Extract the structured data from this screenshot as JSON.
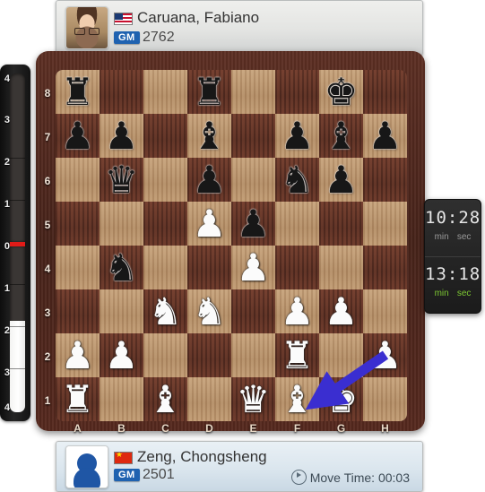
{
  "top_player": {
    "name": "Caruana, Fabiano",
    "title": "GM",
    "rating": "2762",
    "flag": "us-flag-icon",
    "avatar": "player-photo-avatar"
  },
  "bottom_player": {
    "name": "Zeng, Chongsheng",
    "title": "GM",
    "rating": "2501",
    "flag": "cn-flag-icon",
    "avatar": "silhouette-avatar",
    "move_time_label": "Move Time: 00:03"
  },
  "clocks": {
    "top": {
      "time": "10:28",
      "min_label": "min",
      "sec_label": "sec",
      "active": false
    },
    "bottom": {
      "time": "13:18",
      "min_label": "min",
      "sec_label": "sec",
      "active": true
    }
  },
  "evaluation_bar": {
    "labels_top_to_bottom": [
      "4",
      "3",
      "2",
      "1",
      "0",
      "1",
      "2",
      "3",
      "4"
    ],
    "zero_marker_color": "#e01b18",
    "white_fill_from": "-2.0",
    "white_advantage": true
  },
  "board": {
    "files": [
      "A",
      "B",
      "C",
      "D",
      "E",
      "F",
      "G",
      "H"
    ],
    "ranks": [
      "8",
      "7",
      "6",
      "5",
      "4",
      "3",
      "2",
      "1"
    ],
    "light_square_color": "#b08a63",
    "dark_square_color": "#5b2f23",
    "pieces": [
      {
        "sq": "a8",
        "glyph": "♜",
        "side": "b",
        "name": "black-rook"
      },
      {
        "sq": "d8",
        "glyph": "♜",
        "side": "b",
        "name": "black-rook"
      },
      {
        "sq": "g8",
        "glyph": "♚",
        "side": "b",
        "name": "black-king"
      },
      {
        "sq": "a7",
        "glyph": "♟",
        "side": "b",
        "name": "black-pawn"
      },
      {
        "sq": "b7",
        "glyph": "♟",
        "side": "b",
        "name": "black-pawn"
      },
      {
        "sq": "d7",
        "glyph": "♝",
        "side": "b",
        "name": "black-bishop"
      },
      {
        "sq": "f7",
        "glyph": "♟",
        "side": "b",
        "name": "black-pawn"
      },
      {
        "sq": "g7",
        "glyph": "♝",
        "side": "b",
        "name": "black-bishop"
      },
      {
        "sq": "h7",
        "glyph": "♟",
        "side": "b",
        "name": "black-pawn"
      },
      {
        "sq": "b6",
        "glyph": "♛",
        "side": "b",
        "name": "black-queen"
      },
      {
        "sq": "d6",
        "glyph": "♟",
        "side": "b",
        "name": "black-pawn"
      },
      {
        "sq": "f6",
        "glyph": "♞",
        "side": "b",
        "name": "black-knight"
      },
      {
        "sq": "g6",
        "glyph": "♟",
        "side": "b",
        "name": "black-pawn"
      },
      {
        "sq": "d5",
        "glyph": "♟",
        "side": "w",
        "name": "white-pawn"
      },
      {
        "sq": "e5",
        "glyph": "♟",
        "side": "b",
        "name": "black-pawn"
      },
      {
        "sq": "b4",
        "glyph": "♞",
        "side": "b",
        "name": "black-knight"
      },
      {
        "sq": "e4",
        "glyph": "♟",
        "side": "w",
        "name": "white-pawn"
      },
      {
        "sq": "c3",
        "glyph": "♞",
        "side": "w",
        "name": "white-knight"
      },
      {
        "sq": "d3",
        "glyph": "♞",
        "side": "w",
        "name": "white-knight"
      },
      {
        "sq": "f3",
        "glyph": "♟",
        "side": "w",
        "name": "white-pawn"
      },
      {
        "sq": "g3",
        "glyph": "♟",
        "side": "w",
        "name": "white-pawn"
      },
      {
        "sq": "a2",
        "glyph": "♟",
        "side": "w",
        "name": "white-pawn"
      },
      {
        "sq": "b2",
        "glyph": "♟",
        "side": "w",
        "name": "white-pawn"
      },
      {
        "sq": "f2",
        "glyph": "♜",
        "side": "w",
        "name": "white-rook"
      },
      {
        "sq": "h2",
        "glyph": "♟",
        "side": "w",
        "name": "white-pawn"
      },
      {
        "sq": "a1",
        "glyph": "♜",
        "side": "w",
        "name": "white-rook"
      },
      {
        "sq": "c1",
        "glyph": "♝",
        "side": "w",
        "name": "white-bishop"
      },
      {
        "sq": "e1",
        "glyph": "♛",
        "side": "w",
        "name": "white-queen"
      },
      {
        "sq": "f1",
        "glyph": "♝",
        "side": "w",
        "name": "white-bishop"
      },
      {
        "sq": "g1",
        "glyph": "♚",
        "side": "w",
        "name": "white-king"
      }
    ],
    "arrow": {
      "from": "h2",
      "to": "f1",
      "color": "#3a2ed0"
    }
  }
}
